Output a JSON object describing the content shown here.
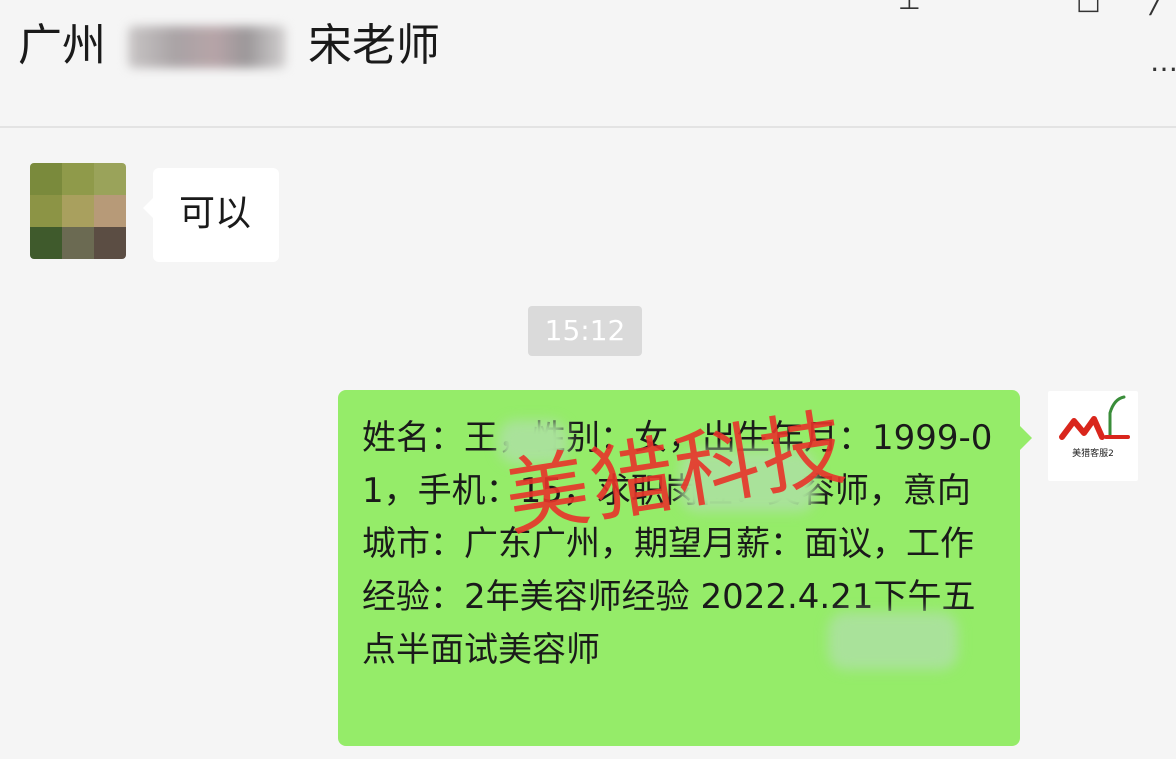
{
  "header": {
    "title_prefix": "广州",
    "title_suffix": "宋老师",
    "pin_icon": "pin-icon",
    "maximize_icon": "maximize-icon",
    "close_icon": "close-icon",
    "more_label": "…"
  },
  "messages": [
    {
      "side": "left",
      "text": "可以",
      "avatar": "pixelated-avatar"
    },
    {
      "type": "timestamp",
      "text": "15:12"
    },
    {
      "side": "right",
      "text": "姓名：王，性别：女，出生年月：1999-01，手机：15，求职岗位：美容师，意向城市：广东广州，期望月薪：面议，工作经验：2年美容师经验 2022.4.21下午五点半面试美容师",
      "avatar": "meilie-logo",
      "avatar_caption": "美猎客服2"
    }
  ],
  "watermark": "美猎科技",
  "colors": {
    "bg": "#f5f5f5",
    "bubble_self": "#95ec69",
    "bubble_other": "#ffffff",
    "timestamp_bg": "#dadada",
    "watermark": "#e8342a"
  }
}
